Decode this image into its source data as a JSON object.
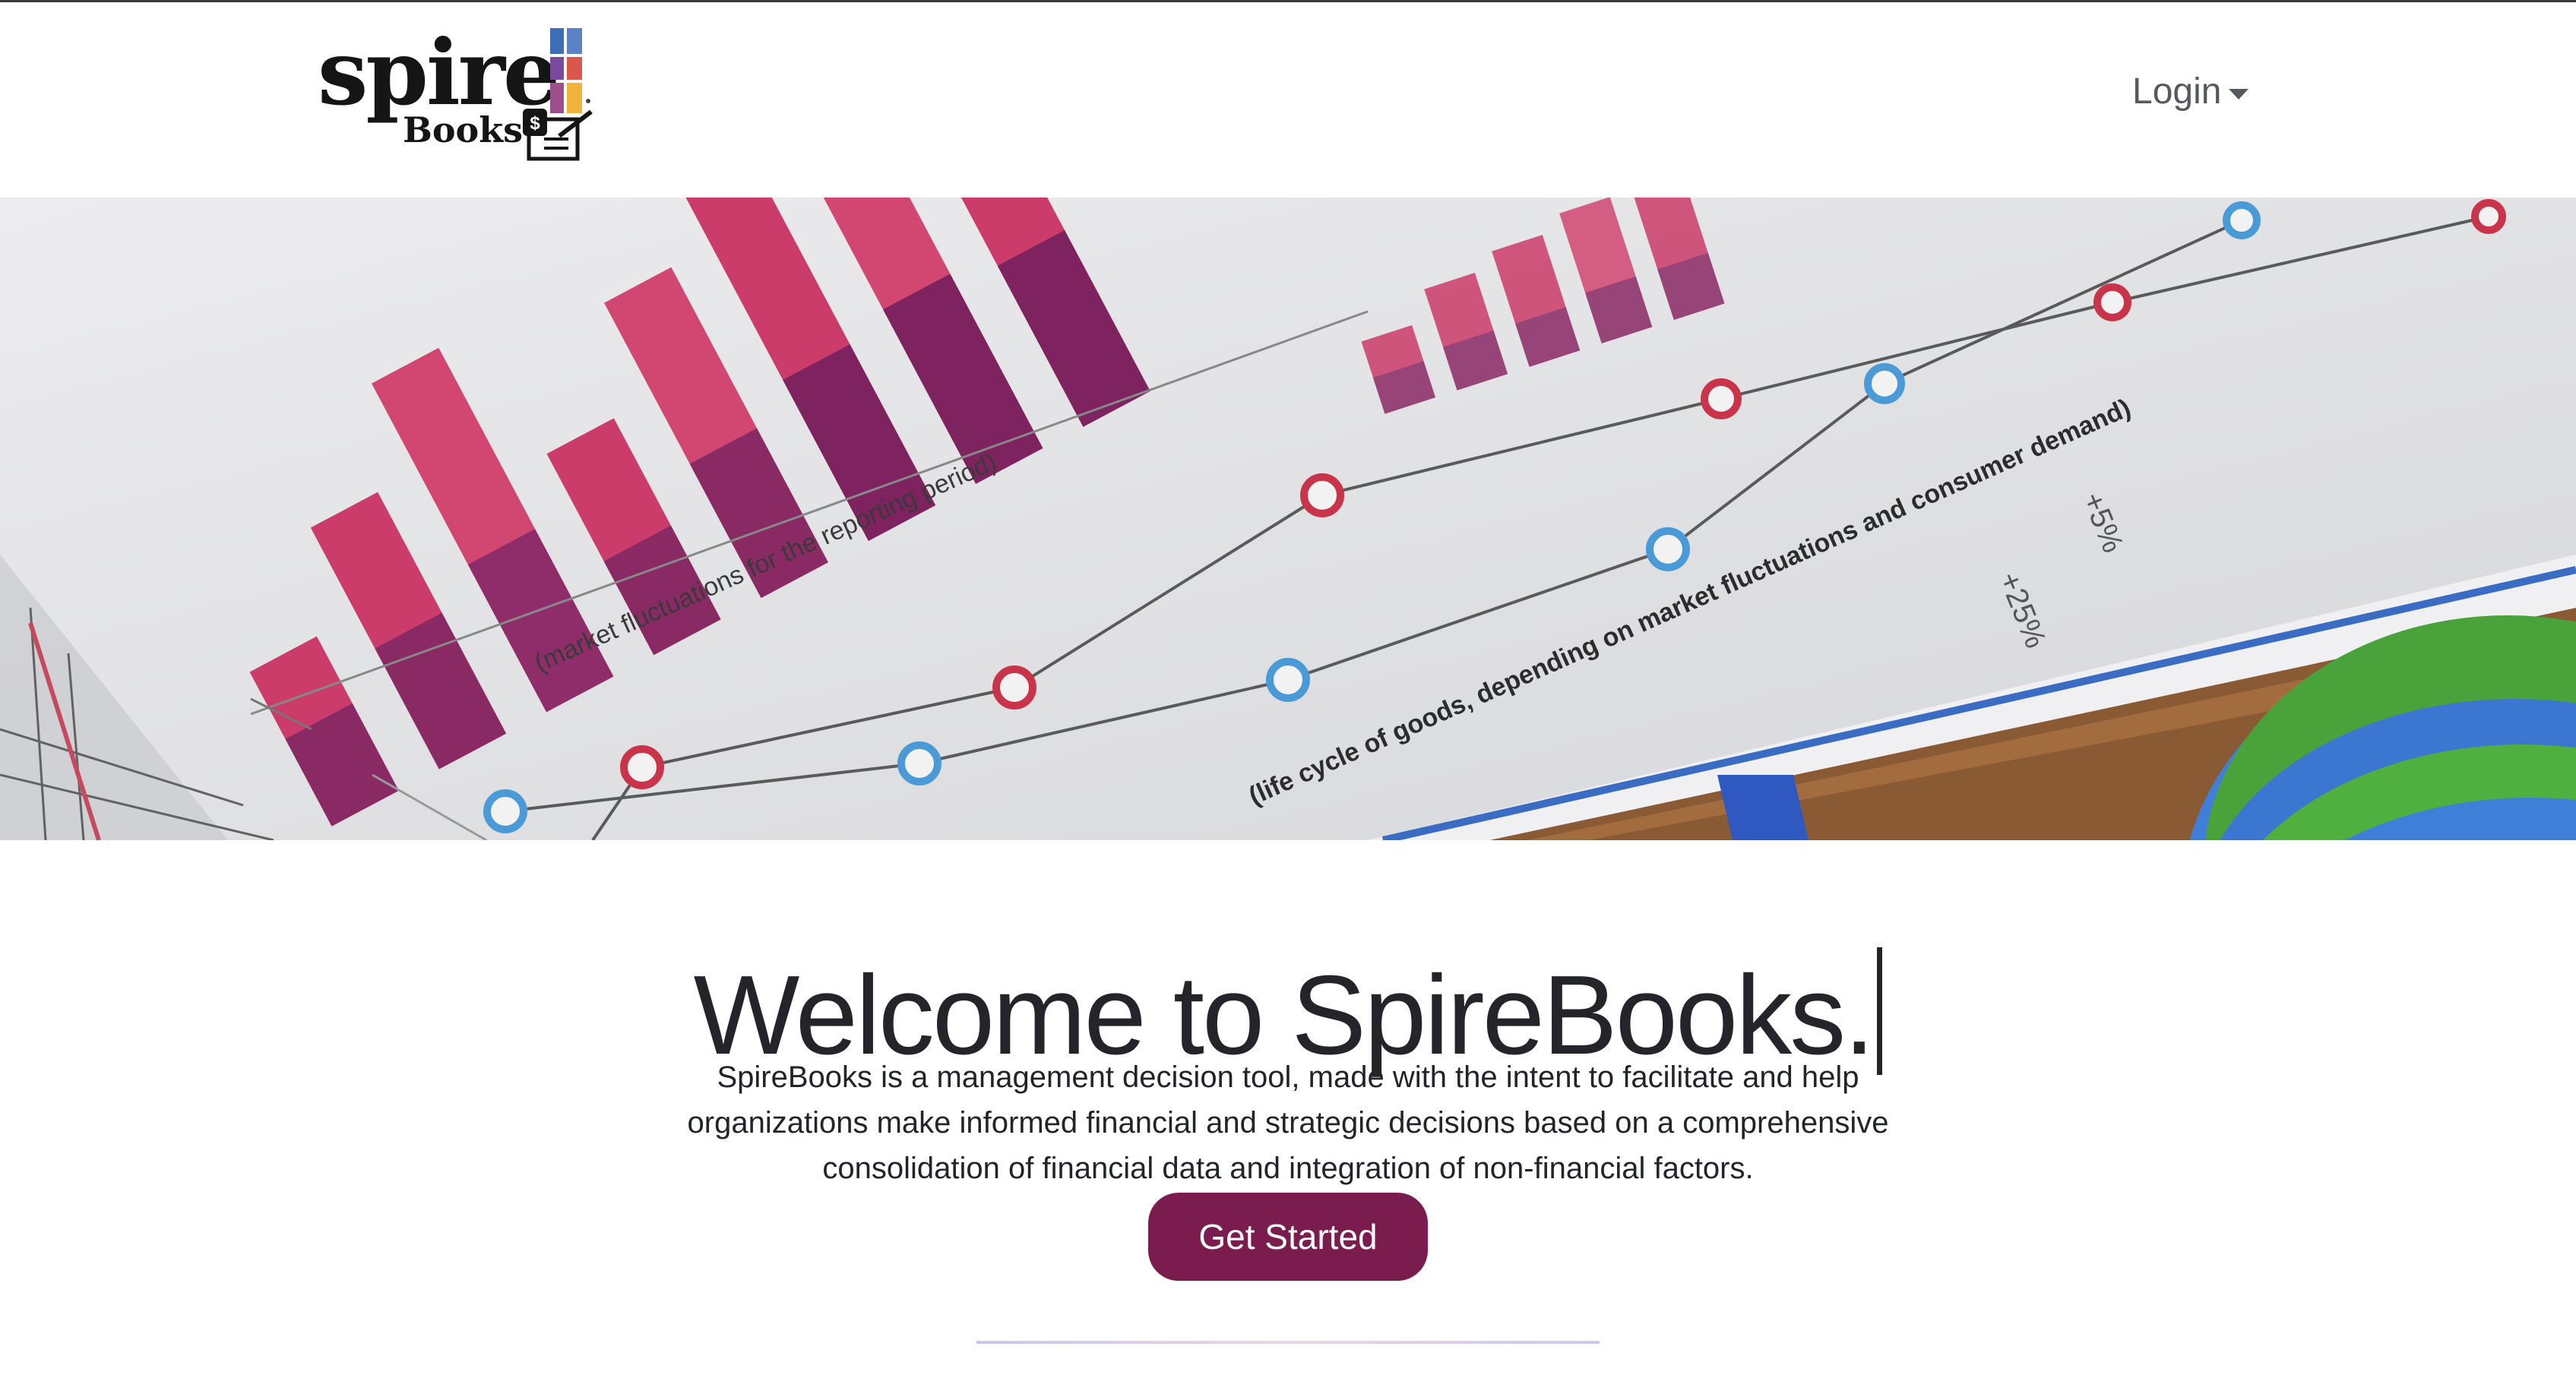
{
  "brand": {
    "wordmark": "spire",
    "subtitle": "Books",
    "badge": "$",
    "colors": {
      "spire_top": "#3e6fb6",
      "spire_mid": "#7b4a9e",
      "spire_bottom": "#d8584b",
      "spire_accent": "#f2b33d"
    }
  },
  "nav": {
    "login_label": "Login"
  },
  "hero": {
    "bar_chart_colors": {
      "pink": "#cc3c6a",
      "purple": "#8a2a65"
    },
    "line_colors": {
      "red": "#c9344a",
      "blue": "#4a9ad8"
    },
    "caption_1": "(market fluctuations for the reporting period)",
    "caption_2": "(life cycle of goods, depending on market fluctuations and consumer demand)",
    "caption_3": "+5%",
    "caption_4": "+25%"
  },
  "main": {
    "title": "Welcome to SpireBooks.",
    "description": "SpireBooks is a management decision tool, made with the intent to facilitate and help organizations make informed financial and strategic decisions based on a comprehensive consolidation of financial data and integration of non-financial factors.",
    "cta_label": "Get Started",
    "accent_color": "#7b1c4f"
  }
}
